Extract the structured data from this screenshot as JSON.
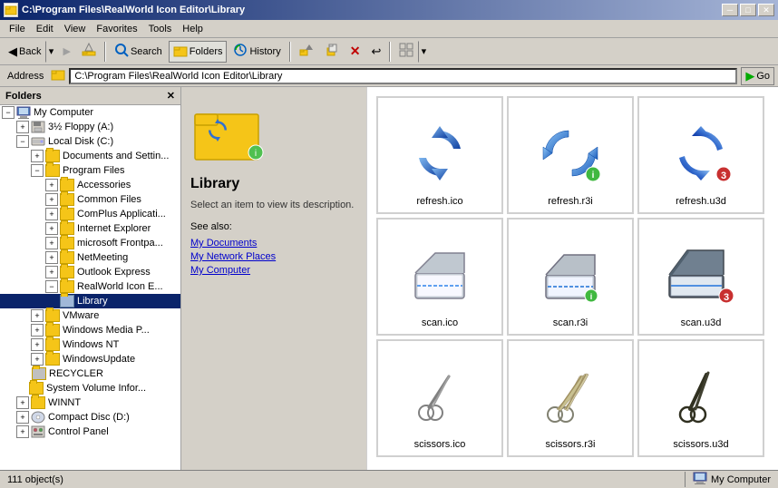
{
  "titlebar": {
    "title": "C:\\Program Files\\RealWorld Icon Editor\\Library",
    "icon": "📁",
    "minimize_label": "─",
    "maximize_label": "□",
    "close_label": "✕"
  },
  "menubar": {
    "items": [
      "File",
      "Edit",
      "View",
      "Favorites",
      "Tools",
      "Help"
    ]
  },
  "toolbar": {
    "back_label": "Back",
    "forward_label": "▶",
    "up_label": "▲",
    "search_label": "Search",
    "folders_label": "Folders",
    "history_label": "History",
    "move_to_label": "Move To",
    "copy_to_label": "Copy To",
    "delete_label": "Delete",
    "undo_label": "Undo",
    "views_label": "Views"
  },
  "addressbar": {
    "label": "Address",
    "value": "C:\\Program Files\\RealWorld Icon Editor\\Library",
    "go_label": "Go"
  },
  "sidebar": {
    "title": "Folders",
    "tree": [
      {
        "id": "my-computer",
        "label": "My Computer",
        "level": 0,
        "expanded": true,
        "type": "computer"
      },
      {
        "id": "floppy",
        "label": "3½ Floppy (A:)",
        "level": 1,
        "expanded": false,
        "type": "drive"
      },
      {
        "id": "local-disk",
        "label": "Local Disk (C:)",
        "level": 1,
        "expanded": true,
        "type": "drive"
      },
      {
        "id": "docs-settings",
        "label": "Documents and Settin...",
        "level": 2,
        "expanded": false,
        "type": "folder"
      },
      {
        "id": "program-files",
        "label": "Program Files",
        "level": 2,
        "expanded": true,
        "type": "folder"
      },
      {
        "id": "accessories",
        "label": "Accessories",
        "level": 3,
        "expanded": false,
        "type": "folder"
      },
      {
        "id": "common-files",
        "label": "Common Files",
        "level": 3,
        "expanded": false,
        "type": "folder"
      },
      {
        "id": "complus",
        "label": "ComPlus Applicati...",
        "level": 3,
        "expanded": false,
        "type": "folder"
      },
      {
        "id": "internet-explorer",
        "label": "Internet Explorer",
        "level": 3,
        "expanded": false,
        "type": "folder"
      },
      {
        "id": "microsoft-frontpa",
        "label": "microsoft Frontpa...",
        "level": 3,
        "expanded": false,
        "type": "folder"
      },
      {
        "id": "netmeeting",
        "label": "NetMeeting",
        "level": 3,
        "expanded": false,
        "type": "folder"
      },
      {
        "id": "outlook-express",
        "label": "Outlook Express",
        "level": 3,
        "expanded": false,
        "type": "folder"
      },
      {
        "id": "realworld-icon-e",
        "label": "RealWorld Icon E...",
        "level": 3,
        "expanded": true,
        "type": "folder"
      },
      {
        "id": "library",
        "label": "Library",
        "level": 4,
        "expanded": false,
        "type": "folder",
        "selected": true
      },
      {
        "id": "vmware",
        "label": "VMware",
        "level": 2,
        "expanded": false,
        "type": "folder"
      },
      {
        "id": "windows-media",
        "label": "Windows Media P...",
        "level": 2,
        "expanded": false,
        "type": "folder"
      },
      {
        "id": "windows-nt",
        "label": "Windows NT",
        "level": 2,
        "expanded": false,
        "type": "folder"
      },
      {
        "id": "windows-update",
        "label": "WindowsUpdate",
        "level": 2,
        "expanded": false,
        "type": "folder"
      },
      {
        "id": "recycler",
        "label": "RECYCLER",
        "level": 1,
        "expanded": false,
        "type": "folder"
      },
      {
        "id": "system-volume",
        "label": "System Volume Infor...",
        "level": 1,
        "expanded": false,
        "type": "folder"
      },
      {
        "id": "winnt",
        "label": "WINNT",
        "level": 1,
        "expanded": false,
        "type": "folder"
      },
      {
        "id": "compact-disc",
        "label": "Compact Disc (D:)",
        "level": 1,
        "expanded": false,
        "type": "drive"
      },
      {
        "id": "control-panel",
        "label": "Control Panel",
        "level": 1,
        "expanded": false,
        "type": "folder"
      }
    ]
  },
  "info_panel": {
    "title": "Library",
    "description": "Select an item to view its description.",
    "see_also_label": "See also:",
    "links": [
      "My Documents",
      "My Network Places",
      "My Computer"
    ]
  },
  "files": [
    {
      "name": "refresh.ico",
      "type": "refresh-ico"
    },
    {
      "name": "refresh.r3i",
      "type": "refresh-r3i"
    },
    {
      "name": "refresh.u3d",
      "type": "refresh-u3d"
    },
    {
      "name": "scan.ico",
      "type": "scan-ico"
    },
    {
      "name": "scan.r3i",
      "type": "scan-r3i"
    },
    {
      "name": "scan.u3d",
      "type": "scan-u3d"
    },
    {
      "name": "scissors.ico",
      "type": "scissors-ico"
    },
    {
      "name": "scissors.r3i",
      "type": "scissors-r3i"
    },
    {
      "name": "scissors.u3d",
      "type": "scissors-u3d"
    }
  ],
  "statusbar": {
    "count": "111 object(s)",
    "computer_label": "My Computer",
    "computer_icon": "🖥"
  }
}
